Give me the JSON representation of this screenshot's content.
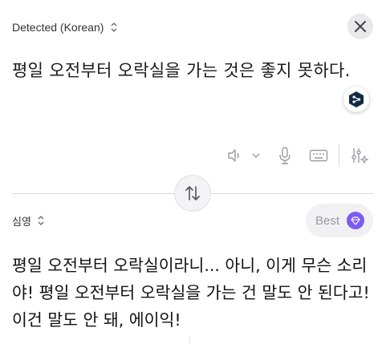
{
  "source": {
    "language_label": "Detected (Korean)",
    "text": "평일 오전부터 오락실을 가는 것은 좋지 못하다."
  },
  "target": {
    "language_label": "심영",
    "quality_label": "Best",
    "text": "평일 오전부터 오락실이라니... 아니, 이게 무슨 소리야! 평일 오전부터 오락실을 가는 건 말도 안 된다고! 이건 말도 안 돼, 에이익!"
  },
  "icons": {
    "close": "close-icon",
    "swap": "swap-vertical-icon",
    "speaker": "speaker-icon",
    "mic": "microphone-icon",
    "keyboard": "keyboard-icon",
    "settings": "sliders-sparkle-icon",
    "extension": "deepl-extension-icon",
    "gem": "gem-icon"
  },
  "colors": {
    "accent": "#7b5cf0",
    "icon_gray": "#9a9aa3"
  }
}
